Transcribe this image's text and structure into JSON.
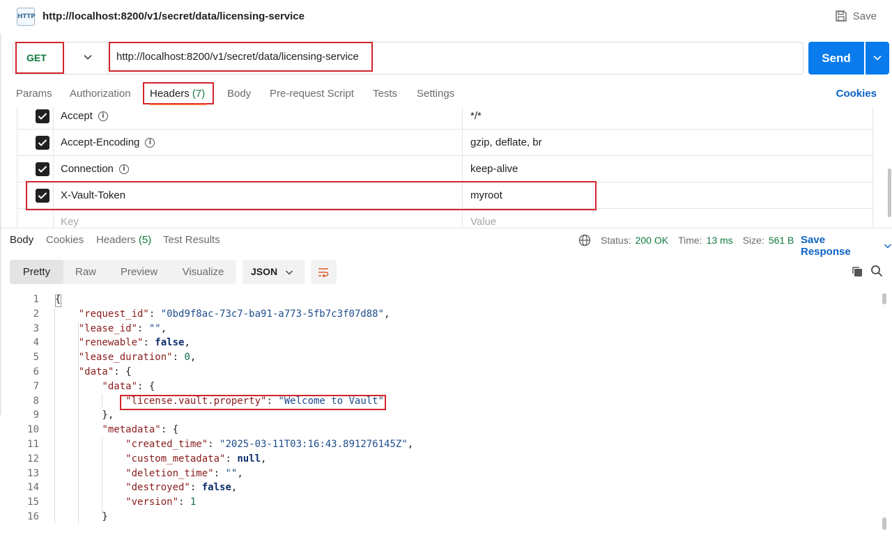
{
  "titlebar": {
    "badge": "HTTP",
    "url": "http://localhost:8200/v1/secret/data/licensing-service",
    "save_label": "Save"
  },
  "request": {
    "method": "GET",
    "url": "http://localhost:8200/v1/secret/data/licensing-service",
    "send_label": "Send"
  },
  "request_tabs": {
    "params": "Params",
    "authorization": "Authorization",
    "headers": "Headers",
    "headers_count": "(7)",
    "body": "Body",
    "prerequest": "Pre-request Script",
    "tests": "Tests",
    "settings": "Settings",
    "cookies": "Cookies"
  },
  "headers": [
    {
      "key": "Accept",
      "value": "*/*",
      "info": true,
      "checked": true
    },
    {
      "key": "Accept-Encoding",
      "value": "gzip, deflate, br",
      "info": true,
      "checked": true
    },
    {
      "key": "Connection",
      "value": "keep-alive",
      "info": true,
      "checked": true
    },
    {
      "key": "X-Vault-Token",
      "value": "myroot",
      "info": false,
      "checked": true
    }
  ],
  "headers_placeholder": {
    "key": "Key",
    "value": "Value"
  },
  "response_tabs": {
    "body": "Body",
    "cookies": "Cookies",
    "headers": "Headers",
    "headers_count": "(5)",
    "test_results": "Test Results"
  },
  "response_status": {
    "status_label": "Status:",
    "status_value": "200 OK",
    "time_label": "Time:",
    "time_value": "13 ms",
    "size_label": "Size:",
    "size_value": "561 B",
    "save_response": "Save Response"
  },
  "view_modes": [
    "Pretty",
    "Raw",
    "Preview",
    "Visualize"
  ],
  "active_view": "Pretty",
  "format": "JSON",
  "icons": {
    "save": "save-icon",
    "copy": "copy-icon",
    "search": "search-icon",
    "wrap": "wrap-lines-icon",
    "globe": "globe-icon"
  },
  "colors": {
    "accent_blue": "#097bed",
    "highlight_red": "#d2232a",
    "method_green": "#0f7a3e",
    "tab_orange": "#ff6c37"
  },
  "code_lines": [
    {
      "n": "1",
      "t": "{"
    },
    {
      "n": "2",
      "t": "    \"request_id\": \"0bd9f8ac-73c7-ba91-a773-5fb7c3f07d88\","
    },
    {
      "n": "3",
      "t": "    \"lease_id\": \"\","
    },
    {
      "n": "4",
      "t": "    \"renewable\": false,"
    },
    {
      "n": "5",
      "t": "    \"lease_duration\": 0,"
    },
    {
      "n": "6",
      "t": "    \"data\": {"
    },
    {
      "n": "7",
      "t": "        \"data\": {"
    },
    {
      "n": "8",
      "t": "            \"license.vault.property\": \"Welcome to Vault\""
    },
    {
      "n": "9",
      "t": "        },"
    },
    {
      "n": "10",
      "t": "        \"metadata\": {"
    },
    {
      "n": "11",
      "t": "            \"created_time\": \"2025-03-11T03:16:43.891276145Z\","
    },
    {
      "n": "12",
      "t": "            \"custom_metadata\": null,"
    },
    {
      "n": "13",
      "t": "            \"deletion_time\": \"\","
    },
    {
      "n": "14",
      "t": "            \"destroyed\": false,"
    },
    {
      "n": "15",
      "t": "            \"version\": 1"
    },
    {
      "n": "16",
      "t": "        }"
    }
  ]
}
